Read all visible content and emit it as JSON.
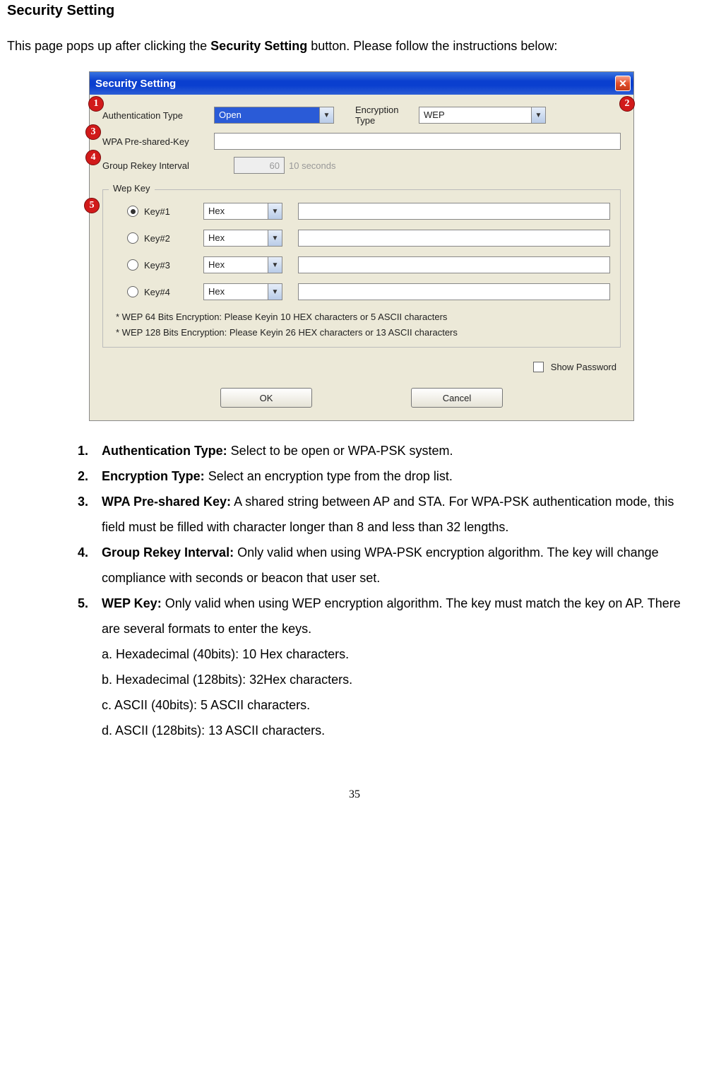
{
  "heading": "Security Setting",
  "intro_pre": "This page pops up after clicking the ",
  "intro_bold": "Security Setting",
  "intro_post": " button. Please follow the instructions below:",
  "dialog": {
    "title": "Security Setting",
    "row1": {
      "lbl": "Authentication Type",
      "value": "Open",
      "lbl2": "Encryption Type",
      "value2": "WEP"
    },
    "row2": {
      "lbl": "WPA Pre-shared-Key"
    },
    "row3": {
      "lbl": "Group Rekey Interval",
      "value": "60",
      "unit": "10 seconds"
    },
    "fieldset": {
      "legend": "Wep Key",
      "keys": [
        {
          "label": "Key#1",
          "fmt": "Hex",
          "checked": true
        },
        {
          "label": "Key#2",
          "fmt": "Hex",
          "checked": false
        },
        {
          "label": "Key#3",
          "fmt": "Hex",
          "checked": false
        },
        {
          "label": "Key#4",
          "fmt": "Hex",
          "checked": false
        }
      ],
      "hint1": "* WEP 64 Bits Encryption:  Please Keyin 10 HEX characters or 5 ASCII characters",
      "hint2": "* WEP 128 Bits Encryption:  Please Keyin 26 HEX characters or 13 ASCII characters"
    },
    "show_password": "Show Password",
    "ok": "OK",
    "cancel": "Cancel",
    "badges": {
      "b1": "1",
      "b2": "2",
      "b3": "3",
      "b4": "4",
      "b5": "5"
    }
  },
  "list": {
    "i1": {
      "num": "1.",
      "b": "Authentication Type:",
      "t": " Select to be open or WPA-PSK system."
    },
    "i2": {
      "num": "2.",
      "b": "Encryption Type:",
      "t": " Select an encryption type from the drop list."
    },
    "i3": {
      "num": "3.",
      "b": "WPA Pre-shared Key:",
      "t": " A shared string between AP and STA. For WPA-PSK authentication mode, this field must be filled with character longer than 8 and less than 32 lengths."
    },
    "i4": {
      "num": "4.",
      "b": "Group Rekey Interval:",
      "t": " Only valid when using WPA-PSK encryption algorithm. The key will change compliance with seconds or beacon that user set."
    },
    "i5": {
      "num": "5.",
      "b": "WEP Key:",
      "t": " Only valid when using WEP encryption algorithm. The key must match the key on AP. There are several formats to enter the keys."
    },
    "s1": "a. Hexadecimal (40bits): 10 Hex characters.",
    "s2": "b. Hexadecimal (128bits): 32Hex characters.",
    "s3": "c. ASCII (40bits): 5 ASCII characters.",
    "s4": "d. ASCII (128bits): 13 ASCII characters."
  },
  "page_number": "35"
}
